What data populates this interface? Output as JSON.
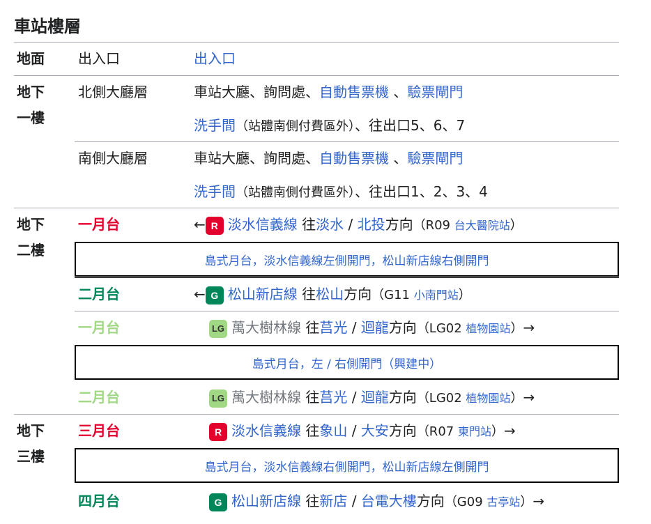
{
  "title": "車站樓層",
  "header": {
    "level": "地面",
    "area": "出入口",
    "content": "出入口"
  },
  "b1": {
    "level_l1": "地下",
    "level_l2": "一樓",
    "north": {
      "area": "北側大廳層",
      "l1_plain": "車站大廳、詢問處、",
      "l1_link1": "自動售票機",
      "l1_sep": " 、",
      "l1_link2": "驗票閘門",
      "l2_link": "洗手間",
      "l2_paren": "（站體南側付費區外）",
      "l2_tail": "、往出口5、6、7"
    },
    "south": {
      "area": "南側大廳層",
      "l1_plain": "車站大廳、詢問處、",
      "l1_link1": "自動售票機",
      "l1_sep": " 、",
      "l1_link2": "驗票閘門",
      "l2_link": "洗手間",
      "l2_paren": "（站體南側付費區外）",
      "l2_tail": "、往出口1、2、3、4"
    }
  },
  "b2": {
    "level_l1": "地下",
    "level_l2": "二樓",
    "p1": {
      "platform": "一月台",
      "arrow": "←",
      "badge": "R",
      "line": "淡水信義線",
      "to": "往",
      "dest1": "淡水",
      "slash": " / ",
      "dest2": "北投",
      "dir": "方向",
      "po": "（R09 ",
      "station": "台大醫院站",
      "pc": "）"
    },
    "island1": "島式月台，淡水信義線左側開門，松山新店線右側開門",
    "p2": {
      "platform": "二月台",
      "arrow": "←",
      "badge": "G",
      "line": "松山新店線",
      "to": "往",
      "dest1": "松山",
      "dir": "方向",
      "po": "（G11 ",
      "station": "小南門站",
      "pc": "）"
    },
    "p3": {
      "platform": "一月台",
      "badge": "LG",
      "line": "萬大樹林線",
      "to": "往",
      "dest1": "莒光",
      "slash": " / ",
      "dest2": "迴龍",
      "dir": "方向",
      "po": "（LG02 ",
      "station": "植物園站",
      "pc": "）",
      "arrow": "→"
    },
    "island2": "島式月台，左 / 右側開門（興建中）",
    "p4": {
      "platform": "二月台",
      "badge": "LG",
      "line": "萬大樹林線",
      "to": "往",
      "dest1": "莒光",
      "slash": " / ",
      "dest2": "迴龍",
      "dir": "方向",
      "po": "（LG02 ",
      "station": "植物園站",
      "pc": "）",
      "arrow": "→"
    }
  },
  "b3": {
    "level_l1": "地下",
    "level_l2": "三樓",
    "p1": {
      "platform": "三月台",
      "badge": "R",
      "line": "淡水信義線",
      "to": "往",
      "dest1": "象山",
      "slash": " / ",
      "dest2": "大安",
      "dir": "方向",
      "po": "（R07 ",
      "station": "東門站",
      "pc": "）",
      "arrow": "→"
    },
    "island": "島式月台，淡水信義線右側開門，松山新店線左側開門",
    "p2": {
      "platform": "四月台",
      "badge": "G",
      "line": "松山新店線",
      "to": "往",
      "dest1": "新店",
      "slash": " / ",
      "dest2": "台電大樓",
      "dir": "方向",
      "po": "（G09 ",
      "station": "古亭站",
      "pc": "）",
      "arrow": "→"
    }
  },
  "colors": {
    "red_line": "#e3002c",
    "green_line": "#008659",
    "lg_line": "#a1d884",
    "link": "#3366cc",
    "text": "#202122",
    "rule": "#a2a9b1"
  }
}
